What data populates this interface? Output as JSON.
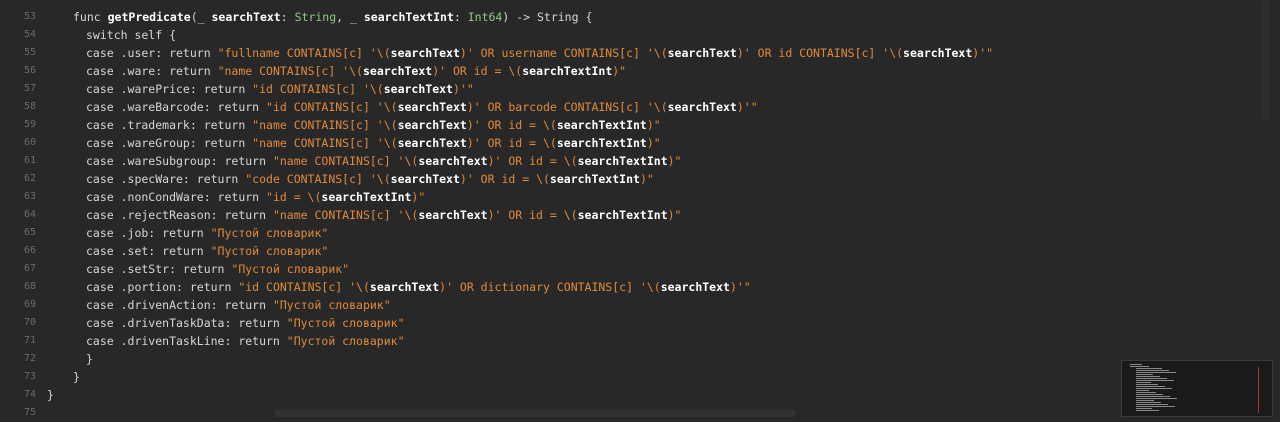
{
  "lines": [
    {
      "n": "53",
      "indent": 2,
      "tokens": [
        [
          "kw",
          "func "
        ],
        [
          "fn",
          "getPredicate"
        ],
        [
          "plain",
          "(_ "
        ],
        [
          "fn",
          "searchText"
        ],
        [
          "plain",
          ": "
        ],
        [
          "ty",
          "String"
        ],
        [
          "plain",
          ", _ "
        ],
        [
          "fn",
          "searchTextInt"
        ],
        [
          "plain",
          ": "
        ],
        [
          "ty",
          "Int64"
        ],
        [
          "plain",
          ") -> "
        ],
        [
          "plain",
          "String"
        ],
        [
          "plain",
          " {"
        ]
      ]
    },
    {
      "n": "54",
      "indent": 3,
      "tokens": [
        [
          "kw",
          "switch self {"
        ]
      ]
    },
    {
      "n": "55",
      "indent": 3,
      "tokens": [
        [
          "kw",
          "case .user: return "
        ],
        [
          "str",
          "\"fullname CONTAINS[c] '\\("
        ],
        [
          "interp",
          "searchText"
        ],
        [
          "str",
          ")' OR username CONTAINS[c] '\\("
        ],
        [
          "interp",
          "searchText"
        ],
        [
          "str",
          ")' OR id CONTAINS[c] '\\("
        ],
        [
          "interp",
          "searchText"
        ],
        [
          "str",
          ")'\""
        ]
      ]
    },
    {
      "n": "56",
      "indent": 3,
      "tokens": [
        [
          "kw",
          "case .ware: return "
        ],
        [
          "str",
          "\"name CONTAINS[c] '\\("
        ],
        [
          "interp",
          "searchText"
        ],
        [
          "str",
          ")' OR id = \\("
        ],
        [
          "interp",
          "searchTextInt"
        ],
        [
          "str",
          ")\""
        ]
      ]
    },
    {
      "n": "57",
      "indent": 3,
      "tokens": [
        [
          "kw",
          "case .warePrice: return "
        ],
        [
          "str",
          "\"id CONTAINS[c] '\\("
        ],
        [
          "interp",
          "searchText"
        ],
        [
          "str",
          ")'\""
        ]
      ]
    },
    {
      "n": "58",
      "indent": 3,
      "tokens": [
        [
          "kw",
          "case .wareBarcode: return "
        ],
        [
          "str",
          "\"id CONTAINS[c] '\\("
        ],
        [
          "interp",
          "searchText"
        ],
        [
          "str",
          ")' OR barcode CONTAINS[c] '\\("
        ],
        [
          "interp",
          "searchText"
        ],
        [
          "str",
          ")'\""
        ]
      ]
    },
    {
      "n": "59",
      "indent": 3,
      "tokens": [
        [
          "kw",
          "case .trademark: return "
        ],
        [
          "str",
          "\"name CONTAINS[c] '\\("
        ],
        [
          "interp",
          "searchText"
        ],
        [
          "str",
          ")' OR id = \\("
        ],
        [
          "interp",
          "searchTextInt"
        ],
        [
          "str",
          ")\""
        ]
      ]
    },
    {
      "n": "60",
      "indent": 3,
      "tokens": [
        [
          "kw",
          "case .wareGroup: return "
        ],
        [
          "str",
          "\"name CONTAINS[c] '\\("
        ],
        [
          "interp",
          "searchText"
        ],
        [
          "str",
          ")' OR id = \\("
        ],
        [
          "interp",
          "searchTextInt"
        ],
        [
          "str",
          ")\""
        ]
      ]
    },
    {
      "n": "61",
      "indent": 3,
      "tokens": [
        [
          "kw",
          "case .wareSubgroup: return "
        ],
        [
          "str",
          "\"name CONTAINS[c] '\\("
        ],
        [
          "interp",
          "searchText"
        ],
        [
          "str",
          ")' OR id = \\("
        ],
        [
          "interp",
          "searchTextInt"
        ],
        [
          "str",
          ")\""
        ]
      ]
    },
    {
      "n": "62",
      "indent": 3,
      "tokens": [
        [
          "kw",
          "case .specWare: return "
        ],
        [
          "str",
          "\"code CONTAINS[c] '\\("
        ],
        [
          "interp",
          "searchText"
        ],
        [
          "str",
          ")' OR id = \\("
        ],
        [
          "interp",
          "searchTextInt"
        ],
        [
          "str",
          ")\""
        ]
      ]
    },
    {
      "n": "63",
      "indent": 3,
      "tokens": [
        [
          "kw",
          "case .nonCondWare: return "
        ],
        [
          "str",
          "\"id = \\("
        ],
        [
          "interp",
          "searchTextInt"
        ],
        [
          "str",
          ")\""
        ]
      ]
    },
    {
      "n": "64",
      "indent": 3,
      "tokens": [
        [
          "kw",
          "case .rejectReason: return "
        ],
        [
          "str",
          "\"name CONTAINS[c] '\\("
        ],
        [
          "interp",
          "searchText"
        ],
        [
          "str",
          ")' OR id = \\("
        ],
        [
          "interp",
          "searchTextInt"
        ],
        [
          "str",
          ")\""
        ]
      ]
    },
    {
      "n": "65",
      "indent": 3,
      "tokens": [
        [
          "kw",
          "case .job: return "
        ],
        [
          "str",
          "\"Пустой словарик\""
        ]
      ]
    },
    {
      "n": "66",
      "indent": 3,
      "tokens": [
        [
          "kw",
          "case .set: return "
        ],
        [
          "str",
          "\"Пустой словарик\""
        ]
      ]
    },
    {
      "n": "67",
      "indent": 3,
      "tokens": [
        [
          "kw",
          "case .setStr: return "
        ],
        [
          "str",
          "\"Пустой словарик\""
        ]
      ]
    },
    {
      "n": "68",
      "indent": 3,
      "tokens": [
        [
          "kw",
          "case .portion: return "
        ],
        [
          "str",
          "\"id CONTAINS[c] '\\("
        ],
        [
          "interp",
          "searchText"
        ],
        [
          "str",
          ")' OR dictionary CONTAINS[c] '\\("
        ],
        [
          "interp",
          "searchText"
        ],
        [
          "str",
          ")'\""
        ]
      ]
    },
    {
      "n": "69",
      "indent": 3,
      "tokens": [
        [
          "kw",
          "case .drivenAction: return "
        ],
        [
          "str",
          "\"Пустой словарик\""
        ]
      ]
    },
    {
      "n": "70",
      "indent": 3,
      "tokens": [
        [
          "kw",
          "case .drivenTaskData: return "
        ],
        [
          "str",
          "\"Пустой словарик\""
        ]
      ]
    },
    {
      "n": "71",
      "indent": 3,
      "tokens": [
        [
          "kw",
          "case .drivenTaskLine: return "
        ],
        [
          "str",
          "\"Пустой словарик\""
        ]
      ]
    },
    {
      "n": "72",
      "indent": 3,
      "tokens": [
        [
          "plain",
          "}"
        ]
      ]
    },
    {
      "n": "73",
      "indent": 2,
      "tokens": [
        [
          "plain",
          "}"
        ]
      ]
    },
    {
      "n": "74",
      "indent": 0,
      "tokens": [
        [
          "plain",
          "}"
        ]
      ]
    },
    {
      "n": "75",
      "indent": 0,
      "tokens": []
    }
  ]
}
